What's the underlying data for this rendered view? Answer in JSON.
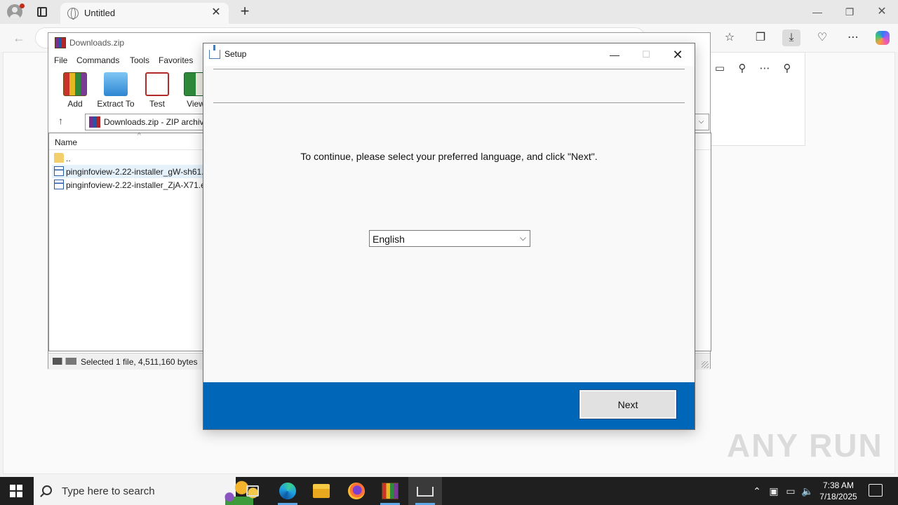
{
  "browser": {
    "tab_title": "Untitled",
    "tab_close": "✕",
    "new_tab": "+",
    "window_controls": {
      "minimize": "—",
      "maximize": "❐",
      "close": "✕"
    },
    "back": "←"
  },
  "winrar": {
    "title": "Downloads.zip",
    "menu": [
      "File",
      "Commands",
      "Tools",
      "Favorites"
    ],
    "tools": [
      "Add",
      "Extract To",
      "Test",
      "View"
    ],
    "path": "Downloads.zip - ZIP archive",
    "column_name": "Name",
    "rows": [
      {
        "name": "..",
        "type": "folder"
      },
      {
        "name": "pinginfoview-2.22-installer_gW-sh61.exe",
        "type": "exe"
      },
      {
        "name": "pinginfoview-2.22-installer_ZjA-X71.exe",
        "type": "exe"
      }
    ],
    "status": "Selected 1 file, 4,511,160 bytes"
  },
  "setup": {
    "title": "Setup",
    "message": "To continue, please select your preferred language, and click \"Next\".",
    "language": "English",
    "next_label": "Next",
    "colors": {
      "footer": "#0067b8"
    }
  },
  "taskbar": {
    "search_placeholder": "Type here to search",
    "time": "7:38 AM",
    "date": "7/18/2025"
  },
  "watermark": "ANY RUN"
}
